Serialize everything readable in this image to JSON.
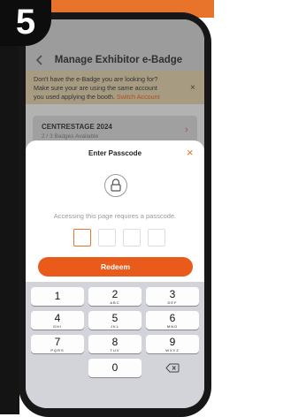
{
  "step_number": "5",
  "header": {
    "title": "Manage Exhibitor e-Badge"
  },
  "banner": {
    "line1": "Don't have the e-Badge you are looking for?",
    "line2": "Make sure your are using the same account",
    "line3": "you used applying the booth.",
    "link": "Switch Account",
    "close": "×"
  },
  "card": {
    "title": "CENTRESTAGE 2024",
    "subtitle": "2 / 3 Badges Available",
    "chevron": "›"
  },
  "sheet": {
    "title": "Enter Passcode",
    "close": "×",
    "description": "Accessing this page requires a passcode.",
    "pin_values": [
      "",
      "",
      "",
      ""
    ],
    "redeem_label": "Redeem"
  },
  "keypad": {
    "keys": [
      {
        "num": "1",
        "letters": ""
      },
      {
        "num": "2",
        "letters": "ABC"
      },
      {
        "num": "3",
        "letters": "DEF"
      },
      {
        "num": "4",
        "letters": "GHI"
      },
      {
        "num": "5",
        "letters": "JKL"
      },
      {
        "num": "6",
        "letters": "MNO"
      },
      {
        "num": "7",
        "letters": "PQRS"
      },
      {
        "num": "8",
        "letters": "TUV"
      },
      {
        "num": "9",
        "letters": "WXYZ"
      },
      {
        "num": "0",
        "letters": ""
      }
    ]
  },
  "icons": [
    "back-icon",
    "close-icon",
    "chevron-right-icon",
    "lock-icon",
    "backspace-icon"
  ],
  "colors": {
    "accent": "#e8732b",
    "button": "#e85b1a",
    "banner": "#f6e3b9"
  }
}
